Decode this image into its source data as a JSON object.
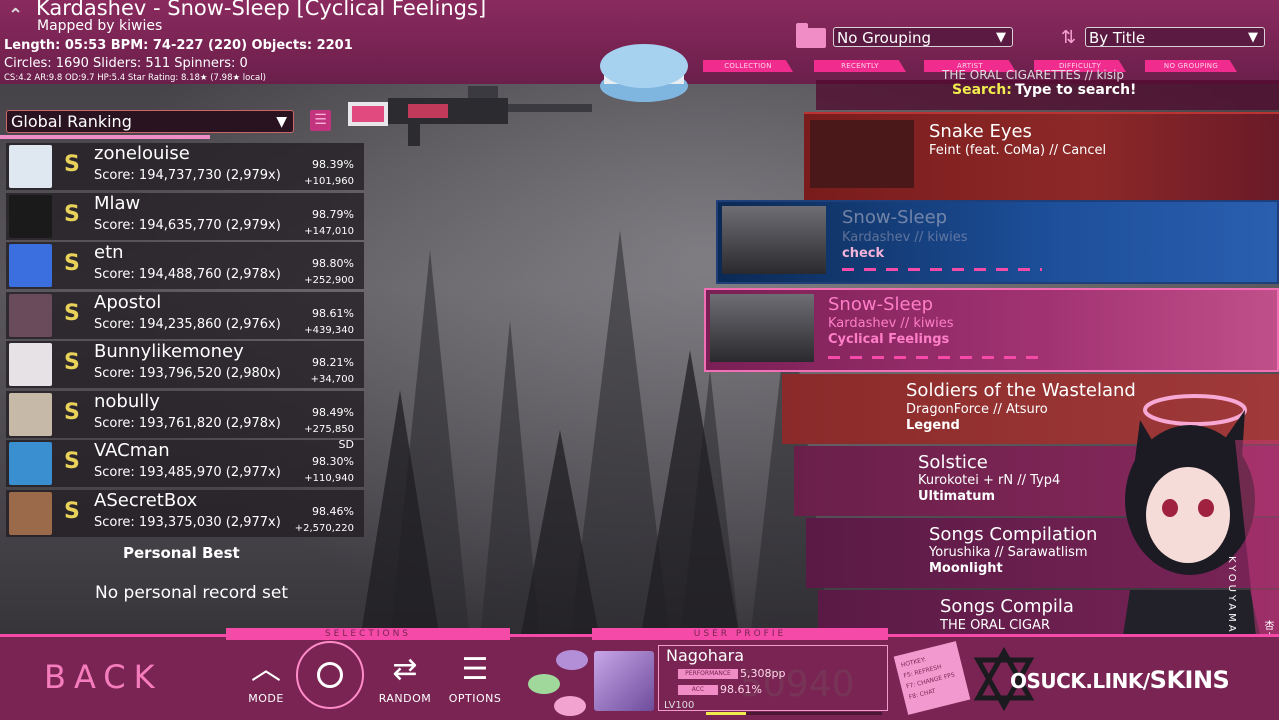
{
  "beatmap": {
    "title": "Kardashev - Snow-Sleep [Cyclical Feelings]",
    "mapper": "Mapped by kiwies",
    "stats_line1": "Length: 05:53 BPM: 74-227 (220) Objects: 2201",
    "stats_line2": "Circles: 1690 Sliders: 511 Spinners: 0",
    "stats_line3": "CS:4.2 AR:9.8 OD:9.7 HP:5.4 Star Rating: 8.18★ (7.98★ local)"
  },
  "grouping": {
    "value": "No Grouping"
  },
  "sorting": {
    "value": "By Title"
  },
  "tabs": [
    "COLLECTION",
    "RECENTLY",
    "ARTIST",
    "DIFFICULTY",
    "NO GROUPING"
  ],
  "ranking": {
    "dropdown": "Global Ranking",
    "scores": [
      {
        "name": "zonelouise",
        "score": "Score: 194,737,730 (2,979x)",
        "mods": "",
        "acc": "98.39%",
        "pp": "+101,960",
        "avatar_color": "#dfe7f0"
      },
      {
        "name": "Mlaw",
        "score": "Score: 194,635,770 (2,979x)",
        "mods": "",
        "acc": "98.79%",
        "pp": "+147,010",
        "avatar_color": "#1a1a1a"
      },
      {
        "name": "etn",
        "score": "Score: 194,488,760 (2,978x)",
        "mods": "",
        "acc": "98.80%",
        "pp": "+252,900",
        "avatar_color": "#3b6fe0"
      },
      {
        "name": "Apostol",
        "score": "Score: 194,235,860 (2,976x)",
        "mods": "",
        "acc": "98.61%",
        "pp": "+439,340",
        "avatar_color": "#6a4b5c"
      },
      {
        "name": "Bunnylikemoney",
        "score": "Score: 193,796,520 (2,980x)",
        "mods": "",
        "acc": "98.21%",
        "pp": "+34,700",
        "avatar_color": "#e6e2e6"
      },
      {
        "name": "nobully",
        "score": "Score: 193,761,820 (2,978x)",
        "mods": "",
        "acc": "98.49%",
        "pp": "+275,850",
        "avatar_color": "#c7b9a8"
      },
      {
        "name": "VACman",
        "score": "Score: 193,485,970 (2,977x)",
        "mods": "SD",
        "acc": "98.30%",
        "pp": "+110,940",
        "avatar_color": "#3a8fd0"
      },
      {
        "name": "ASecretBox",
        "score": "Score: 193,375,030 (2,977x)",
        "mods": "",
        "acc": "98.46%",
        "pp": "+2,570,220",
        "avatar_color": "#9a6a4a"
      }
    ],
    "grade": "S",
    "personal_best_label": "Personal Best",
    "no_record": "No personal record set"
  },
  "search": {
    "cut_text": "THE ORAL CIGARETTES // kisip",
    "label": "Search:",
    "value": "Type to search!"
  },
  "songs": [
    {
      "title": "Snake Eyes",
      "artist": "Feint (feat. CoMa) // Cancel",
      "diff": ""
    },
    {
      "title": "Snow-Sleep",
      "artist": "Kardashev // kiwies",
      "diff": "check"
    },
    {
      "title": "Snow-Sleep",
      "artist": "Kardashev // kiwies",
      "diff": "Cyclical Feelings"
    },
    {
      "title": "Soldiers of the Wasteland",
      "artist": "DragonForce // Atsuro",
      "diff": "Legend"
    },
    {
      "title": "Solstice",
      "artist": "Kurokotei + rN // Typ4",
      "diff": "Ultimatum"
    },
    {
      "title": "Songs Compilation",
      "artist": "Yorushika // Sarawatlism",
      "diff": "Moonlight"
    },
    {
      "title": "Songs Compila",
      "artist": "THE ORAL CIGAR",
      "diff": ""
    }
  ],
  "footer": {
    "back": "BACK",
    "selections": "SELECTIONS",
    "user_profile": "USER PROFIE",
    "mode": "MODE",
    "random": "RANDOM",
    "options": "OPTIONS"
  },
  "user": {
    "name": "Nagohara",
    "performance_label": "PERFORMANCE",
    "pp": "5,308pp",
    "acc_label": "ACC",
    "acc": "98.61%",
    "level": "LV100",
    "rank_bg": "50940"
  },
  "hotkey": {
    "lines": [
      "HOTKEY:",
      "F5: REFRESH",
      "F7: CHANGE FPS",
      "F8: CHAT"
    ]
  },
  "skin": {
    "brand": "OSUCK.LINK/",
    "suffix": "SKINS",
    "vertical": "KYOUYAMA KAZUSA",
    "vertical_jp": "杏山カズサ"
  },
  "colors": {
    "accent": "#f54aa7",
    "header": "#7a2453",
    "grade": "#e8d25a",
    "search_label": "#f2ec4e"
  }
}
